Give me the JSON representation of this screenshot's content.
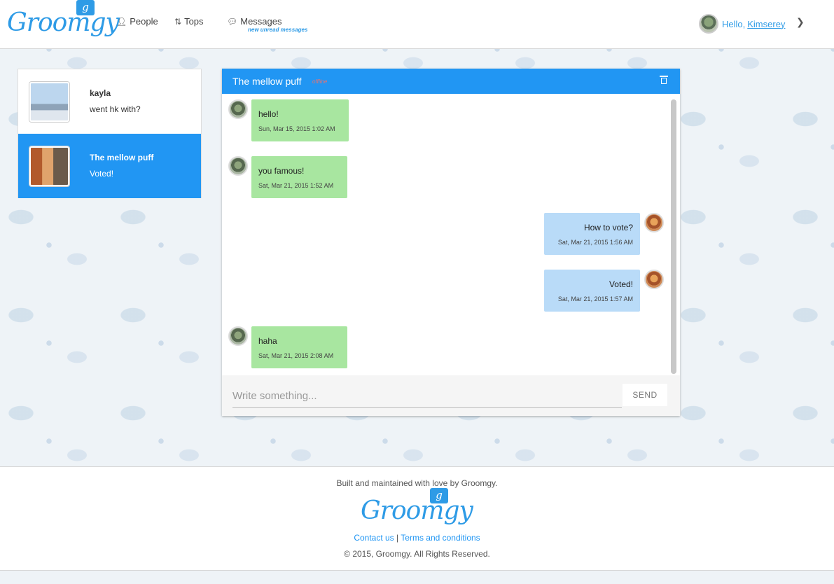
{
  "header": {
    "logo_text": "Groomgy",
    "logo_badge": "g",
    "nav": {
      "people": "People",
      "tops": "Tops",
      "messages": "Messages",
      "messages_sub": "new unread messages"
    },
    "greeting": "Hello,",
    "username": "Kimserey"
  },
  "conversations": [
    {
      "name": "kayla",
      "preview": "went hk with?",
      "active": false
    },
    {
      "name": "The mellow puff",
      "preview": "Voted!",
      "active": true
    }
  ],
  "chat": {
    "title": "The mellow puff",
    "status": "offline",
    "messages": [
      {
        "text": "hello!",
        "time": "Sun, Mar 15, 2015 1:02 AM",
        "direction": "in"
      },
      {
        "text": "you famous!",
        "time": "Sat, Mar 21, 2015 1:52 AM",
        "direction": "in"
      },
      {
        "text": "How to vote?",
        "time": "Sat, Mar 21, 2015 1:56 AM",
        "direction": "out"
      },
      {
        "text": "Voted!",
        "time": "Sat, Mar 21, 2015 1:57 AM",
        "direction": "out"
      },
      {
        "text": "haha",
        "time": "Sat, Mar 21, 2015 2:08 AM",
        "direction": "in"
      }
    ],
    "input_placeholder": "Write something...",
    "send_label": "SEND"
  },
  "footer": {
    "built": "Built and maintained with love by Groomgy.",
    "logo_text": "Groomgy",
    "logo_badge": "g",
    "contact": "Contact us",
    "separator": "|",
    "terms": "Terms and conditions",
    "copyright": "© 2015, Groomgy. All Rights Reserved."
  },
  "colors": {
    "brand": "#2e9be6",
    "active": "#2196f3",
    "incoming_bubble": "#a8e6a0",
    "outgoing_bubble": "#b9dbf8",
    "offline": "#e57373"
  }
}
